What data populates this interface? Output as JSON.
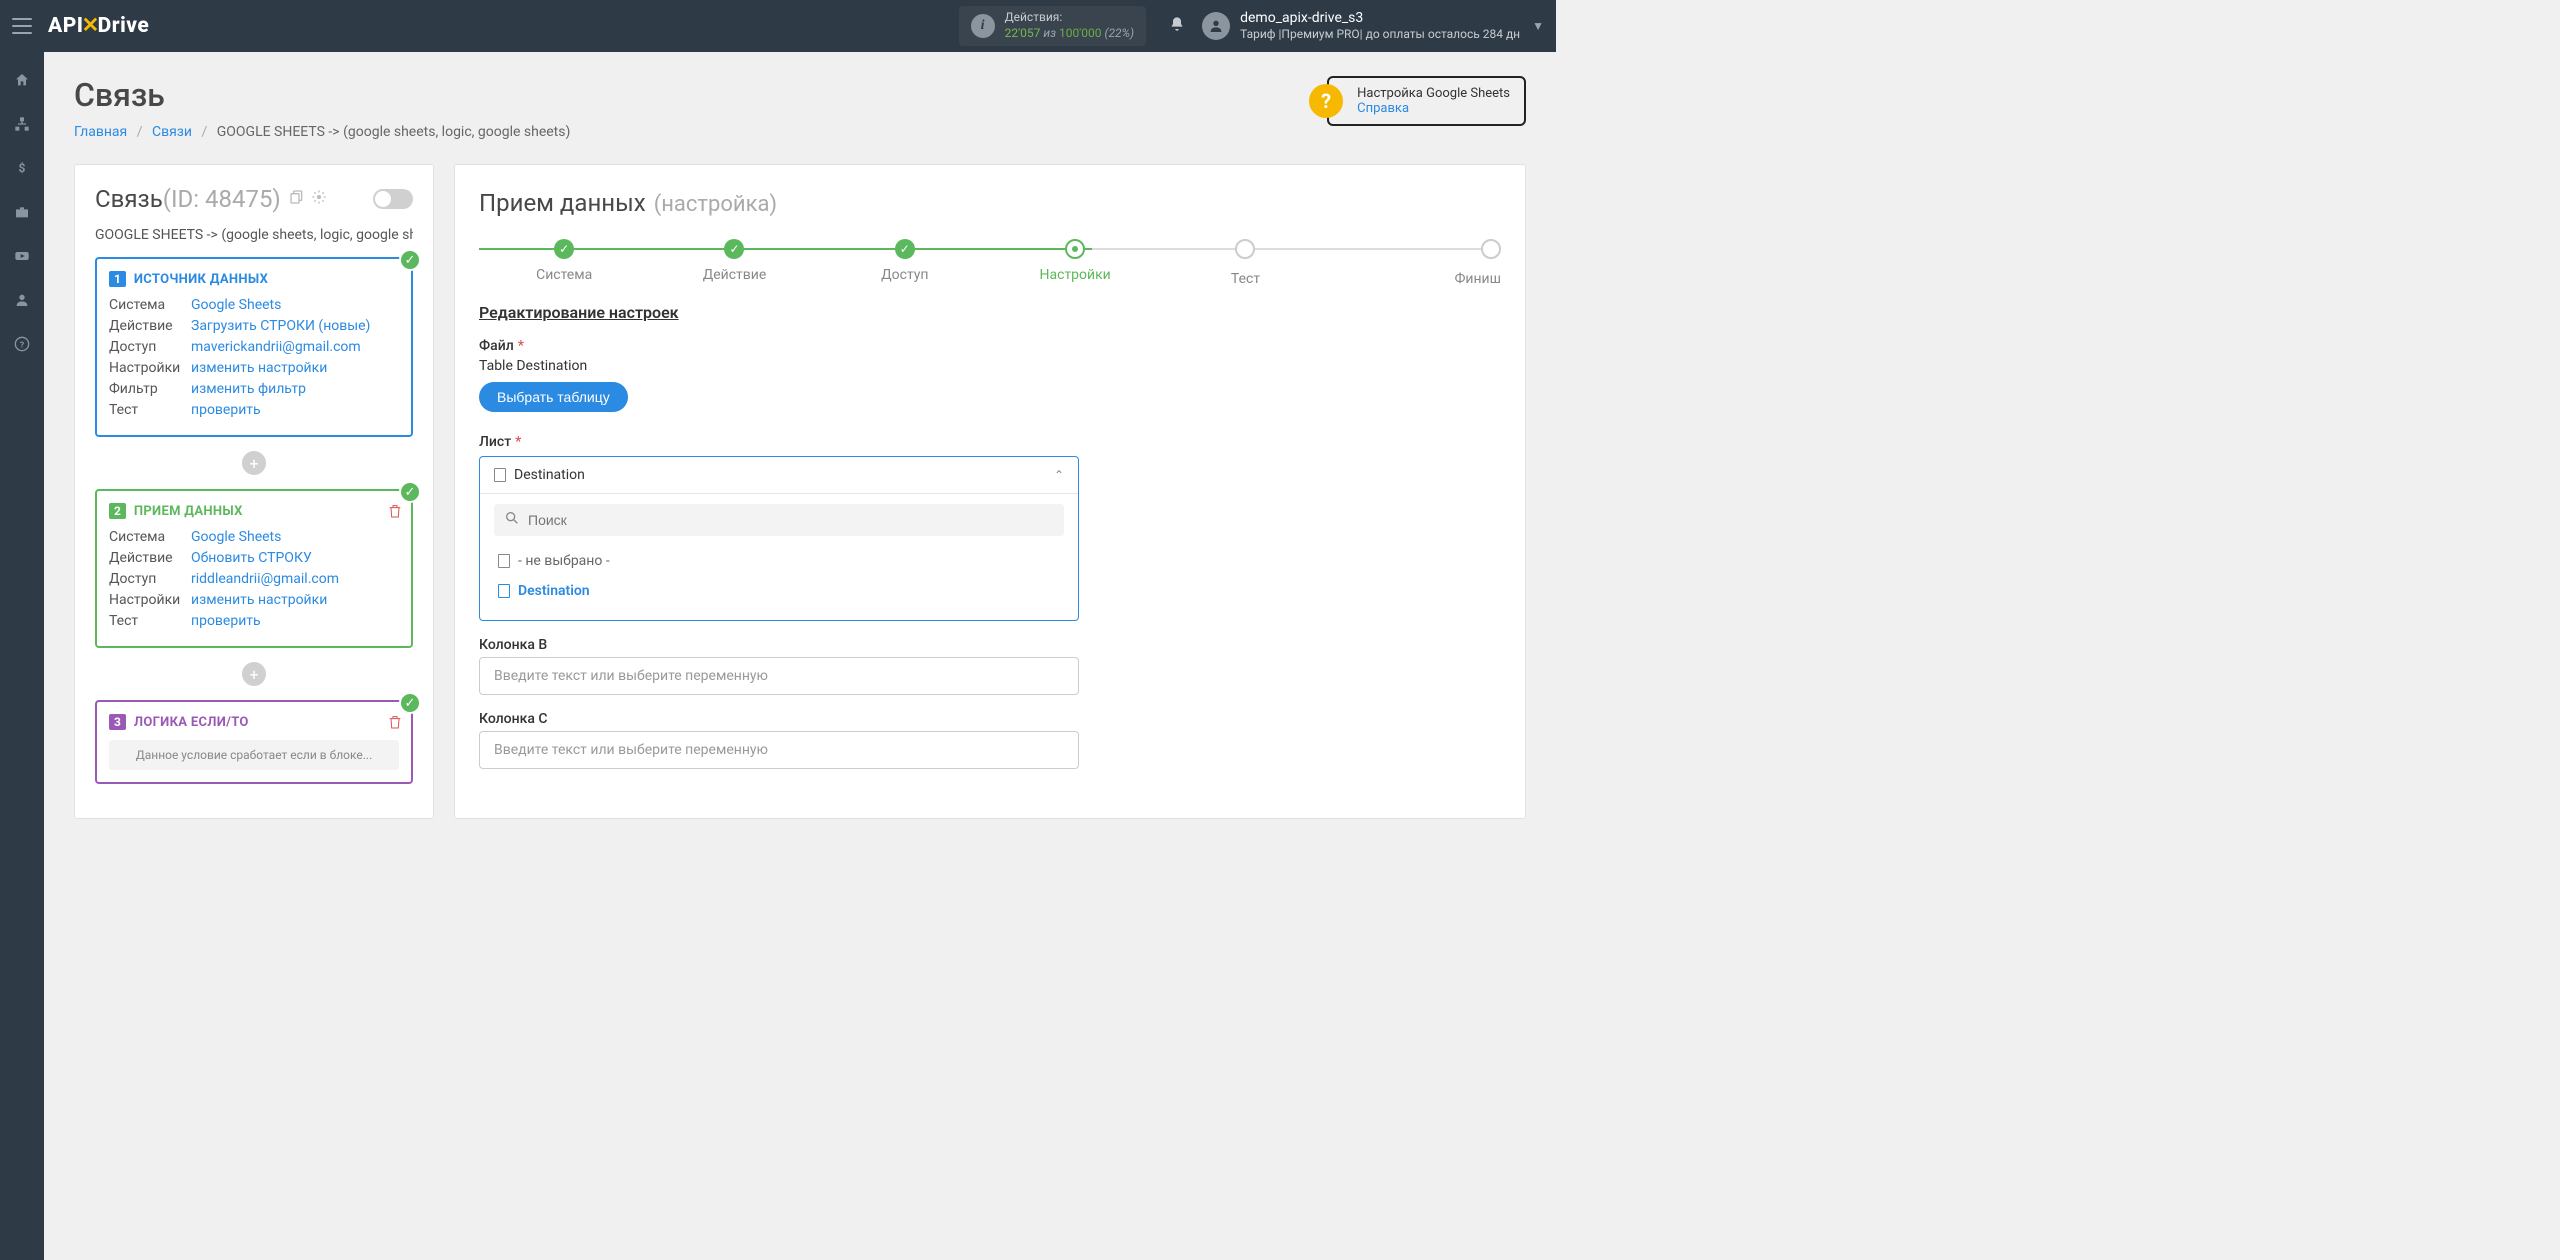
{
  "brand": {
    "part1": "API",
    "part2": "Drive"
  },
  "topbar": {
    "actions_label": "Действия:",
    "actions_count": "22'057",
    "actions_of": " из ",
    "actions_total": "100'000",
    "actions_pct": " (22%)"
  },
  "user": {
    "name": "demo_apix-drive_s3",
    "tariff_line": "Тариф |Премиум PRO| до оплаты осталось 284 дн"
  },
  "page": {
    "title": "Связь",
    "crumb_home": "Главная",
    "crumb_links": "Связи",
    "crumb_current": "GOOGLE SHEETS -> (google sheets, logic, google sheets)"
  },
  "help": {
    "line1": "Настройка Google Sheets",
    "line2": "Справка"
  },
  "conn": {
    "title": "Связь",
    "id": " (ID: 48475)",
    "sub": "GOOGLE SHEETS -> (google sheets, logic, google sheets)"
  },
  "block1": {
    "title": "ИСТОЧНИК ДАННЫХ",
    "rows": [
      {
        "k": "Система",
        "v": "Google Sheets"
      },
      {
        "k": "Действие",
        "v": "Загрузить СТРОКИ (новые)"
      },
      {
        "k": "Доступ",
        "v": "maverickandrii@gmail.com"
      },
      {
        "k": "Настройки",
        "v": "изменить настройки"
      },
      {
        "k": "Фильтр",
        "v": "изменить фильтр"
      },
      {
        "k": "Тест",
        "v": "проверить"
      }
    ]
  },
  "block2": {
    "title": "ПРИЕМ ДАННЫХ",
    "rows": [
      {
        "k": "Система",
        "v": "Google Sheets"
      },
      {
        "k": "Действие",
        "v": "Обновить СТРОКУ"
      },
      {
        "k": "Доступ",
        "v": "riddleandrii@gmail.com"
      },
      {
        "k": "Настройки",
        "v": "изменить настройки"
      },
      {
        "k": "Тест",
        "v": "проверить"
      }
    ]
  },
  "block3": {
    "title": "ЛОГИКА ЕСЛИ/ТО",
    "note": "Данное условие сработает если в блоке..."
  },
  "right": {
    "title": "Прием данных",
    "sub": "(настройка)"
  },
  "steps": [
    {
      "label": "Система",
      "state": "done"
    },
    {
      "label": "Действие",
      "state": "done"
    },
    {
      "label": "Доступ",
      "state": "done"
    },
    {
      "label": "Настройки",
      "state": "curr"
    },
    {
      "label": "Тест",
      "state": "todo"
    },
    {
      "label": "Финиш",
      "state": "todo"
    }
  ],
  "form": {
    "section": "Редактирование настроек",
    "file_label": "Файл",
    "file_value": "Table Destination",
    "file_btn": "Выбрать таблицу",
    "sheet_label": "Лист",
    "sheet_selected": "Destination",
    "search_ph": "Поиск",
    "opt_none": "- не выбрано -",
    "opt_dest": "Destination",
    "colB_label": "Колонка B",
    "col_input_ph": "Введите текст или выберите переменную",
    "colC_label": "Колонка C"
  }
}
